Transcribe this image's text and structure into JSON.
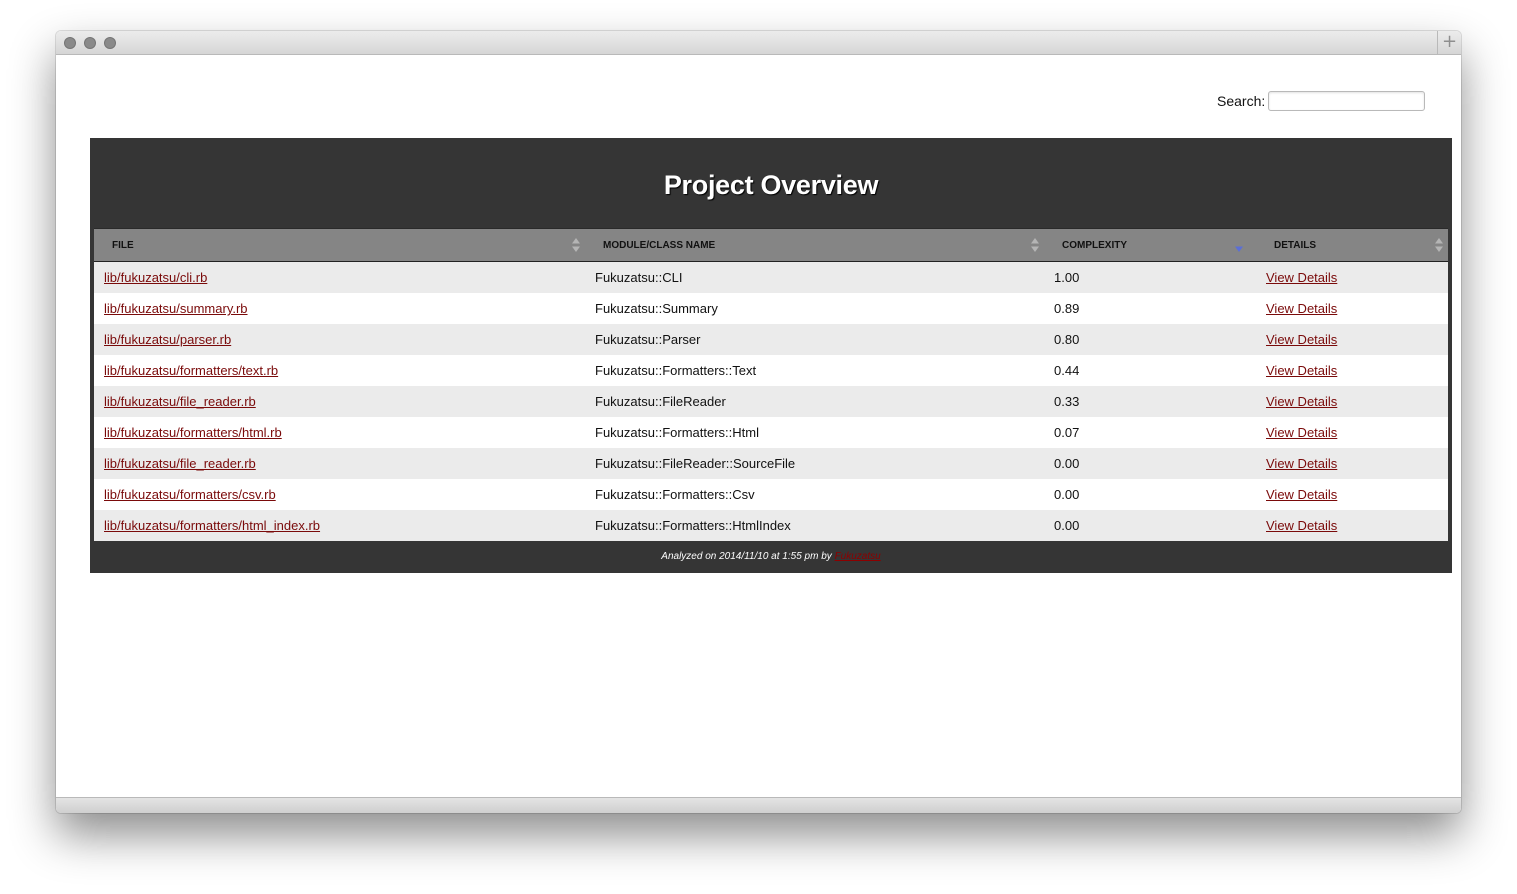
{
  "window": {
    "new_tab_symbol": "+"
  },
  "search": {
    "label": "Search:",
    "value": "",
    "placeholder": ""
  },
  "panel": {
    "title": "Project Overview",
    "columns": [
      "FILE",
      "MODULE/CLASS NAME",
      "COMPLEXITY",
      "DETAILS"
    ],
    "sorted_column": "COMPLEXITY",
    "sort_direction": "descending",
    "rows": [
      {
        "file": "lib/fukuzatsu/cli.rb",
        "module": "Fukuzatsu::CLI",
        "complexity": "1.00",
        "details": "View Details"
      },
      {
        "file": "lib/fukuzatsu/summary.rb",
        "module": "Fukuzatsu::Summary",
        "complexity": "0.89",
        "details": "View Details"
      },
      {
        "file": "lib/fukuzatsu/parser.rb",
        "module": "Fukuzatsu::Parser",
        "complexity": "0.80",
        "details": "View Details"
      },
      {
        "file": "lib/fukuzatsu/formatters/text.rb",
        "module": "Fukuzatsu::Formatters::Text",
        "complexity": "0.44",
        "details": "View Details"
      },
      {
        "file": "lib/fukuzatsu/file_reader.rb",
        "module": "Fukuzatsu::FileReader",
        "complexity": "0.33",
        "details": "View Details"
      },
      {
        "file": "lib/fukuzatsu/formatters/html.rb",
        "module": "Fukuzatsu::Formatters::Html",
        "complexity": "0.07",
        "details": "View Details"
      },
      {
        "file": "lib/fukuzatsu/file_reader.rb",
        "module": "Fukuzatsu::FileReader::SourceFile",
        "complexity": "0.00",
        "details": "View Details"
      },
      {
        "file": "lib/fukuzatsu/formatters/csv.rb",
        "module": "Fukuzatsu::Formatters::Csv",
        "complexity": "0.00",
        "details": "View Details"
      },
      {
        "file": "lib/fukuzatsu/formatters/html_index.rb",
        "module": "Fukuzatsu::Formatters::HtmlIndex",
        "complexity": "0.00",
        "details": "View Details"
      }
    ],
    "footer_text": "Analyzed on 2014/11/10 at 1:55 pm by",
    "footer_link": "Fukuzatsu"
  },
  "colors": {
    "panel_bg": "#353535",
    "header_bg": "#858585",
    "link": "#7a0a0a",
    "row_alt": "#ebebeb",
    "sort_active": "#5b6fd6"
  }
}
